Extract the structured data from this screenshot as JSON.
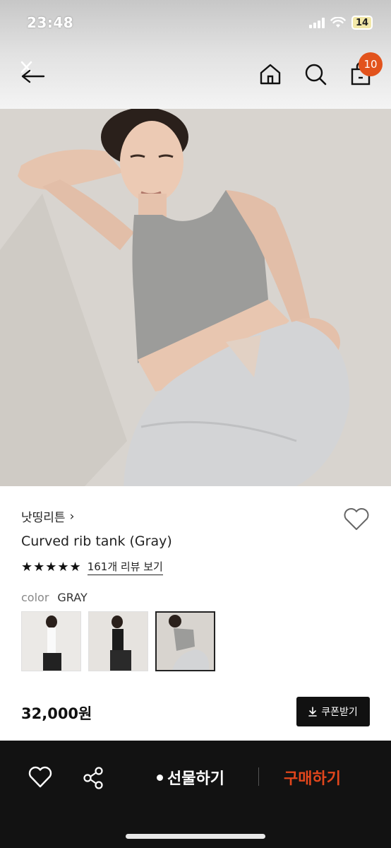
{
  "status_bar": {
    "time": "23:48",
    "battery": "14"
  },
  "nav": {
    "cart_count": "10"
  },
  "product": {
    "brand": "낫띵리튼",
    "brand_chevron": "›",
    "name": "Curved rib tank (Gray)",
    "stars": "★★★★★",
    "review_link": "161개 리뷰 보기",
    "color_label": "color",
    "color_value": "GRAY",
    "swatches": [
      "white",
      "black",
      "gray"
    ],
    "selected_swatch": "gray",
    "price": "32,000원",
    "coupon_button": "쿠폰받기"
  },
  "bottom_bar": {
    "gift_label": "선물하기",
    "buy_label": "구매하기",
    "buy_color": "#e2461c"
  },
  "colors": {
    "badge": "#e2531c",
    "bottom_bg": "#121212"
  }
}
